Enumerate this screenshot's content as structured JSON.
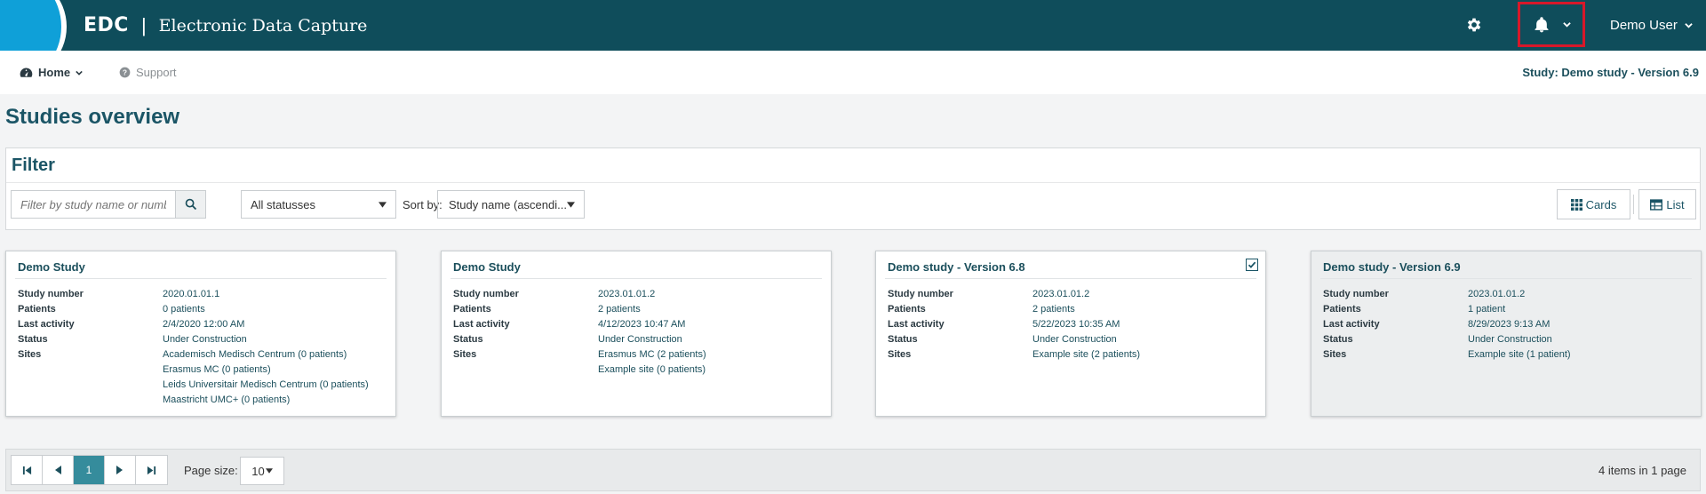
{
  "header": {
    "brand_short": "EDC",
    "brand_sep": "|",
    "brand_long": "Electronic Data Capture",
    "user_name": "Demo User",
    "bar_color": "#0f4d5b",
    "accent_color": "#0fa0d8",
    "highlight_color": "#d7182a",
    "icons": [
      "gear-icon",
      "bell-icon",
      "chevron-down-icon"
    ]
  },
  "nav": {
    "home_label": "Home",
    "support_label": "Support",
    "study_label": "Study: Demo study - Version 6.9"
  },
  "page_title": "Studies overview",
  "filter": {
    "title": "Filter",
    "search_placeholder": "Filter by study name or number...",
    "status_value": "All statusses",
    "sort_label": "Sort by:",
    "sort_value": "Study name (ascendi...",
    "cards_label": "Cards",
    "list_label": "List"
  },
  "labels": {
    "study_number": "Study number",
    "patients": "Patients",
    "last_activity": "Last activity",
    "status": "Status",
    "sites": "Sites"
  },
  "studies": [
    {
      "title": "Demo Study",
      "study_number": "2020.01.01.1",
      "patients": "0 patients",
      "last_activity": "2/4/2020 12:00 AM",
      "status": "Under Construction",
      "sites": [
        "Academisch Medisch Centrum (0 patients)",
        "Erasmus MC (0 patients)",
        "Leids Universitair Medisch Centrum (0 patients)",
        "Maastricht UMC+ (0 patients)"
      ],
      "checked": false,
      "selected": false
    },
    {
      "title": "Demo Study",
      "study_number": "2023.01.01.2",
      "patients": "2 patients",
      "last_activity": "4/12/2023 10:47 AM",
      "status": "Under Construction",
      "sites": [
        "Erasmus MC (2 patients)",
        "Example site (0 patients)"
      ],
      "checked": false,
      "selected": false
    },
    {
      "title": "Demo study - Version 6.8",
      "study_number": "2023.01.01.2",
      "patients": "2 patients",
      "last_activity": "5/22/2023 10:35 AM",
      "status": "Under Construction",
      "sites": [
        "Example site (2 patients)"
      ],
      "checked": true,
      "selected": false
    },
    {
      "title": "Demo study - Version 6.9",
      "study_number": "2023.01.01.2",
      "patients": "1 patient",
      "last_activity": "8/29/2023 9:13 AM",
      "status": "Under Construction",
      "sites": [
        "Example site (1 patient)"
      ],
      "checked": false,
      "selected": true
    }
  ],
  "pager": {
    "current_page": "1",
    "page_size_label": "Page size:",
    "page_size_value": "10",
    "info": "4 items in 1 page"
  }
}
